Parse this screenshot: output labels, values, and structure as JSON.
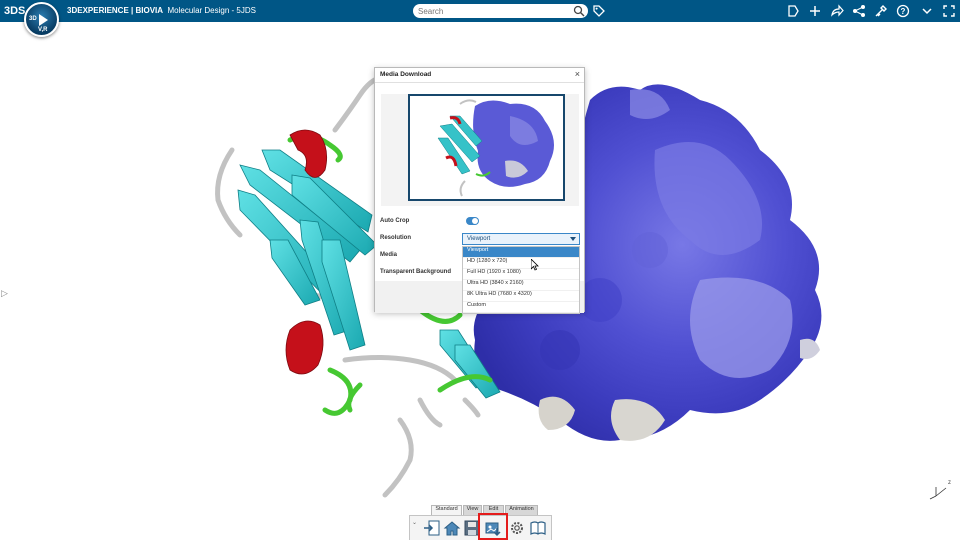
{
  "topbar": {
    "logo_text": "3DS",
    "compass_top": "3D",
    "compass_bottom": "V,R",
    "brand": "3DEXPERIENCE | BIOVIA",
    "app_title": "Molecular Design - 5JDS",
    "search_placeholder": "Search",
    "icons": [
      "bookmark-icon",
      "plus-icon",
      "share-icon",
      "network-icon",
      "tools-icon",
      "help-icon",
      "chevron-down-icon",
      "fullscreen-icon"
    ],
    "color": "#005686"
  },
  "dialog": {
    "title": "Media Download",
    "close": "×",
    "labels": {
      "auto_crop": "Auto Crop",
      "resolution": "Resolution",
      "media": "Media",
      "transparent_background": "Transparent Background"
    },
    "auto_crop_on": true,
    "resolution_value": "Viewport",
    "resolution_options": [
      "Viewport",
      "HD (1280 x 720)",
      "Full HD (1920 x 1080)",
      "Ultra HD (3840 x 2160)",
      "8K Ultra HD (7680 x 4320)",
      "Custom"
    ],
    "selected_index": 0
  },
  "axis": {
    "label": "z"
  },
  "toolbar": {
    "tabs": [
      "Standard",
      "View",
      "Edit",
      "Animation"
    ],
    "active_tab": "Standard",
    "tools": [
      "import-icon",
      "home-icon",
      "save-icon",
      "media-download-icon",
      "settings-icon",
      "book-icon"
    ],
    "highlighted_tool": "media-download-icon"
  },
  "colors": {
    "accent": "#3a87c8",
    "helix": "#d0121a",
    "strand": "#35c2c8",
    "loop": "#46c832",
    "coil": "#c8c8c8",
    "surface": "#5a5ad6",
    "highlight": "#e41b1b"
  }
}
